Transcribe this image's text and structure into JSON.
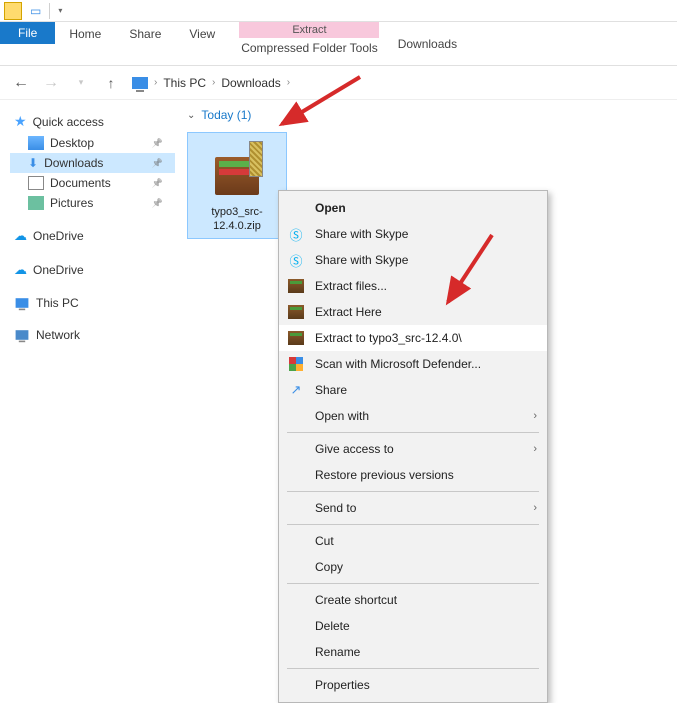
{
  "qat": {},
  "ribbon": {
    "file": "File",
    "home": "Home",
    "share": "Share",
    "view": "View",
    "tool_head": "Extract",
    "tool_label": "Compressed Folder Tools",
    "right": "Downloads"
  },
  "address": {
    "loc1": "This PC",
    "loc2": "Downloads"
  },
  "sidebar": {
    "quick": "Quick access",
    "desktop": "Desktop",
    "downloads": "Downloads",
    "documents": "Documents",
    "pictures": "Pictures",
    "onedrive1": "OneDrive",
    "onedrive2": "OneDrive",
    "thispc": "This PC",
    "network": "Network"
  },
  "content": {
    "group": "Today (1)",
    "file_name": "typo3_src-12.4.0.zip"
  },
  "ctx": {
    "open": "Open",
    "skype1": "Share with Skype",
    "skype2": "Share with Skype",
    "extract_files": "Extract files...",
    "extract_here": "Extract Here",
    "extract_to": "Extract to typo3_src-12.4.0\\",
    "defender": "Scan with Microsoft Defender...",
    "share": "Share",
    "open_with": "Open with",
    "give_access": "Give access to",
    "restore": "Restore previous versions",
    "send_to": "Send to",
    "cut": "Cut",
    "copy": "Copy",
    "shortcut": "Create shortcut",
    "delete": "Delete",
    "rename": "Rename",
    "properties": "Properties"
  }
}
